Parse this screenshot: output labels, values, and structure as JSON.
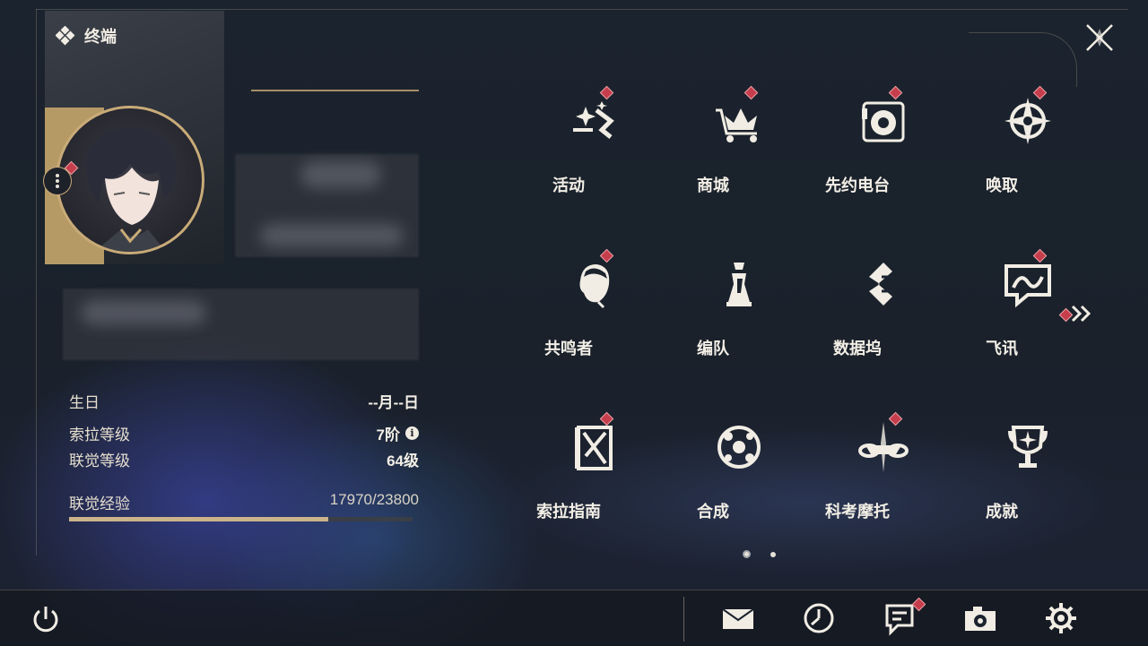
{
  "header": {
    "title": "终端"
  },
  "profile": {
    "birthday_label": "生日",
    "birthday_value": "--月--日",
    "sola_level_label": "索拉等级",
    "sola_level_value": "7阶",
    "union_level_label": "联觉等级",
    "union_level_value": "64级",
    "exp_label": "联觉经验",
    "exp_value": "17970/23800",
    "exp_progress": 0.755
  },
  "menu": {
    "items": [
      {
        "label": "活动",
        "icon": "sparkle-icon",
        "badge": true
      },
      {
        "label": "商城",
        "icon": "crown-cart-icon",
        "badge": true
      },
      {
        "label": "先约电台",
        "icon": "radio-icon",
        "badge": true
      },
      {
        "label": "唤取",
        "icon": "compass-star-icon",
        "badge": true
      },
      {
        "label": "共鸣者",
        "icon": "character-head-icon",
        "badge": true
      },
      {
        "label": "编队",
        "icon": "chess-pieces-icon",
        "badge": false
      },
      {
        "label": "数据坞",
        "icon": "data-dock-icon",
        "badge": false
      },
      {
        "label": "飞讯",
        "icon": "chat-bubble-icon",
        "badge": true
      },
      {
        "label": "索拉指南",
        "icon": "guide-book-icon",
        "badge": true
      },
      {
        "label": "合成",
        "icon": "synthesis-icon",
        "badge": false
      },
      {
        "label": "科考摩托",
        "icon": "motorbike-icon",
        "badge": true
      },
      {
        "label": "成就",
        "icon": "trophy-icon",
        "badge": false
      }
    ]
  },
  "pager": {
    "pages": 2,
    "current": 1
  },
  "bottom_bar": {
    "icons": [
      "power-icon",
      "mail-icon",
      "clock-icon",
      "notice-icon",
      "camera-icon",
      "settings-icon"
    ],
    "notice_badge": true
  },
  "colors": {
    "accent_gold": "#c8ab78",
    "badge_red": "#c63d4c",
    "background": "#1b232e"
  }
}
